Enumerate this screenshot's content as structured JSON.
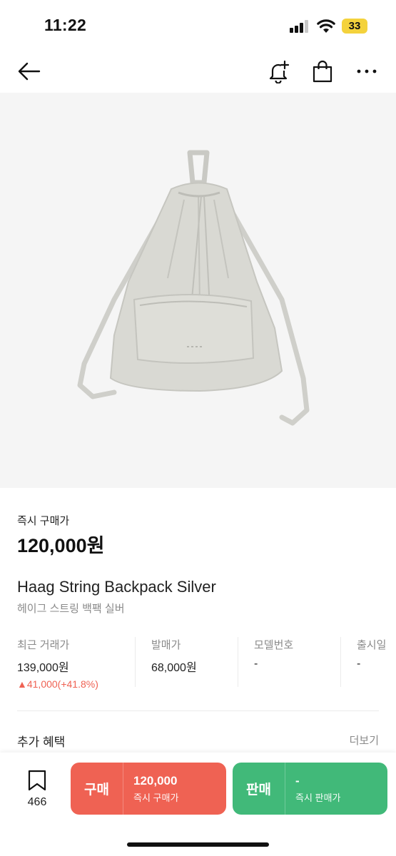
{
  "status_bar": {
    "time": "11:22",
    "battery": "33"
  },
  "nav": {
    "back_icon": "arrow-left-icon",
    "alert_icon": "bell-plus-icon",
    "bag_icon": "shopping-bag-icon",
    "more_icon": "more-horizontal-icon"
  },
  "product": {
    "instant_buy_label": "즉시 구매가",
    "instant_buy_price": "120,000원",
    "name_en": "Haag String Backpack Silver",
    "name_ko": "헤이그 스트링 백팩 실버"
  },
  "stats": [
    {
      "label": "최근 거래가",
      "value": "139,000원",
      "change": "▲41,000(+41.8%)"
    },
    {
      "label": "발매가",
      "value": "68,000원"
    },
    {
      "label": "모델번호",
      "value": "-"
    },
    {
      "label": "출시일",
      "value": "-"
    }
  ],
  "benefits": {
    "title": "추가 혜택",
    "more": "더보기"
  },
  "bottom": {
    "wish_count": "466",
    "buy": {
      "label": "구매",
      "price": "120,000",
      "sub": "즉시 구매가"
    },
    "sell": {
      "label": "판매",
      "price": "-",
      "sub": "즉시 판매가"
    }
  },
  "colors": {
    "buy": "#ef6253",
    "sell": "#41b979",
    "change_up": "#ef6253"
  }
}
